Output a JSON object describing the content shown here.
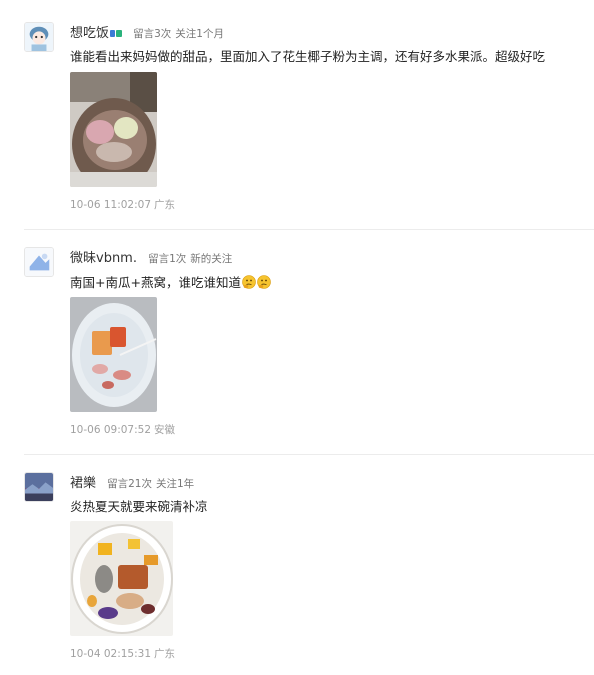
{
  "comments": [
    {
      "user": "想吃饭",
      "has_badge": true,
      "badge_icon": "tag-badge-icon",
      "message_count": "留言3次",
      "follow_status": "关注1个月",
      "text": "谁能看出来妈妈做的甜品，里面加入了花生椰子粉为主调，还有好多水果派。超级好吃",
      "image": "dessert-photo",
      "time": "10-06 11:02:07",
      "location": "广东"
    },
    {
      "user": "微昧vbnm.",
      "message_count": "留言1次",
      "follow_status": "新的关注",
      "text": "南国+南瓜+燕窝，谁吃谁知道",
      "emojis": [
        "thinking-face-icon",
        "thinking-face-icon"
      ],
      "image": "bird-nest-dessert-photo",
      "time": "10-06 09:07:52",
      "location": "安徽"
    },
    {
      "user": "裙樂",
      "message_count": "留言21次",
      "follow_status": "关注1年",
      "text": "炎热夏天就要来碗清补凉",
      "image": "qingbuliang-photo",
      "time": "10-04 02:15:31",
      "location": "广东"
    }
  ],
  "colors": {
    "text": "#222222",
    "meta": "#777777",
    "footer": "#a0a0a0",
    "divider": "#ececec"
  }
}
